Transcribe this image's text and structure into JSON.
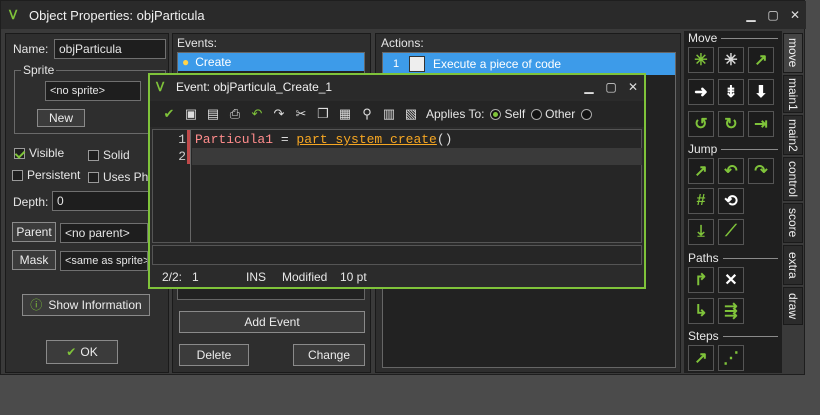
{
  "window": {
    "title": "Object Properties: objParticula"
  },
  "left": {
    "name_label": "Name:",
    "name_value": "objParticula",
    "sprite_label": "Sprite",
    "sprite_value": "<no sprite>",
    "new_label": "New",
    "visible_label": "Visible",
    "solid_label": "Solid",
    "persistent_label": "Persistent",
    "uses_physics_label": "Uses Phy",
    "depth_label": "Depth:",
    "depth_value": "0",
    "parent_label": "Parent",
    "parent_value": "<no parent>",
    "mask_label": "Mask",
    "mask_value": "<same as sprite>",
    "show_info_label": "Show Information",
    "ok_label": "OK"
  },
  "events": {
    "header": "Events:",
    "items": [
      "Create"
    ],
    "add_label": "Add Event",
    "delete_label": "Delete",
    "change_label": "Change"
  },
  "actions": {
    "header": "Actions:",
    "items": [
      {
        "num": "1",
        "label": "Execute a piece of code"
      }
    ]
  },
  "side": {
    "tabs": [
      "move",
      "main1",
      "main2",
      "control",
      "score",
      "extra",
      "draw"
    ],
    "sections": {
      "move": "Move",
      "jump": "Jump",
      "paths": "Paths",
      "steps": "Steps"
    }
  },
  "code_window": {
    "title": "Event: objParticula_Create_1",
    "applies_to_label": "Applies To:",
    "self_label": "Self",
    "other_label": "Other",
    "line_numbers": [
      "1",
      "2"
    ],
    "line1_var": "Particula1",
    "line1_op": " = ",
    "line1_func": "part_system_create",
    "line1_paren": "()",
    "status": {
      "pos": "2/2:",
      "col": "1",
      "mode": "INS",
      "modified": "Modified",
      "font_size": "10 pt"
    }
  },
  "colors": {
    "accent": "#7fc33a",
    "selection": "#3d9be9",
    "func": "#f5a623",
    "var": "#ff7f7f"
  }
}
